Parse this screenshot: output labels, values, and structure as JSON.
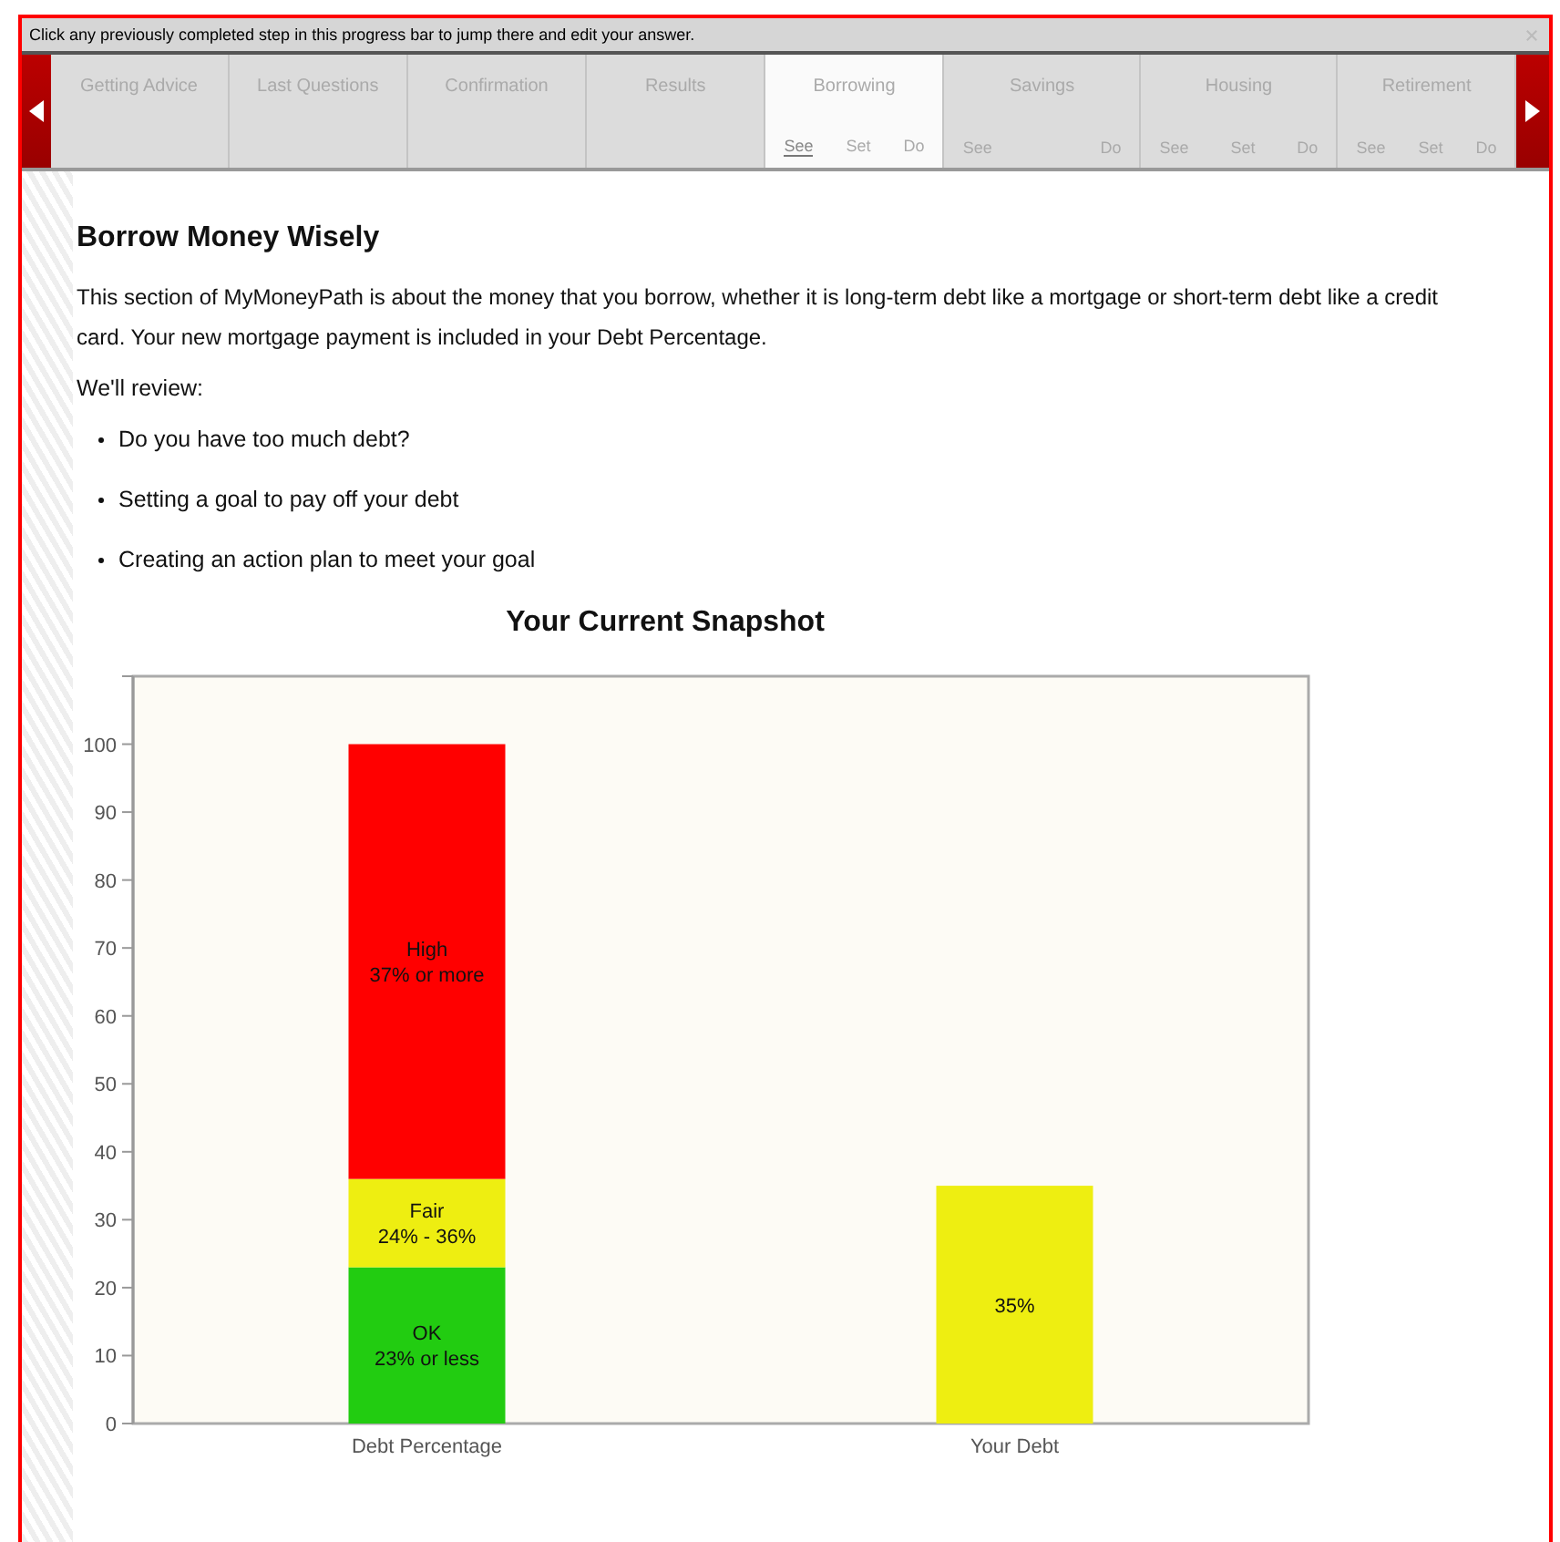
{
  "info_bar": {
    "text": "Click any previously completed step in this progress bar to jump there and edit your answer."
  },
  "tabs": [
    {
      "label": "Getting Advice",
      "selected": false
    },
    {
      "label": "Last Questions",
      "selected": false
    },
    {
      "label": "Confirmation",
      "selected": false
    },
    {
      "label": "Results",
      "selected": false
    },
    {
      "label": "Borrowing",
      "selected": true,
      "steps": [
        {
          "label": "See",
          "selected": true
        },
        {
          "label": "Set",
          "selected": false
        },
        {
          "label": "Do",
          "selected": false
        }
      ]
    },
    {
      "label": "Savings",
      "selected": false,
      "steps": [
        {
          "label": "See",
          "selected": false
        },
        {
          "label": "Do",
          "selected": false
        }
      ]
    },
    {
      "label": "Housing",
      "selected": false,
      "steps": [
        {
          "label": "See",
          "selected": false
        },
        {
          "label": "Set",
          "selected": false
        },
        {
          "label": "Do",
          "selected": false
        }
      ]
    },
    {
      "label": "Retirement",
      "selected": false,
      "steps": [
        {
          "label": "See",
          "selected": false
        },
        {
          "label": "Set",
          "selected": false
        },
        {
          "label": "Do",
          "selected": false
        }
      ]
    }
  ],
  "content": {
    "heading": "Borrow Money Wisely",
    "intro": "This section of MyMoneyPath is about the money that you borrow, whether it is long-term debt like a mortgage or short-term debt like a credit card. Your new mortgage payment is included in your Debt Percentage.",
    "review_label": "We'll review:",
    "bullets": [
      "Do you have too much debt?",
      "Setting a goal to pay off your debt",
      "Creating an action plan to meet your goal"
    ]
  },
  "snapshot": {
    "chart_data": {
      "type": "bar",
      "title": "Your Current Snapshot",
      "categories": [
        "Debt Percentage",
        "Your Debt"
      ],
      "stacked": true,
      "ylim": [
        0,
        110
      ],
      "yticks": [
        0,
        10,
        20,
        30,
        40,
        50,
        60,
        70,
        80,
        90,
        100
      ],
      "series": [
        {
          "color": "#22cc11",
          "values": [
            23,
            null
          ]
        },
        {
          "color": "#eeee11",
          "values": [
            13,
            35
          ],
          "value_labels": [
            null,
            "35%"
          ]
        },
        {
          "color": "#ff0000",
          "values": [
            64,
            null
          ]
        }
      ],
      "annotations": [
        {
          "x": "Debt Percentage",
          "y": 23,
          "text": "OK\n23% or less"
        },
        {
          "x": "Debt Percentage",
          "y": 36,
          "text": "Fair\n24% - 36%"
        },
        "High\n37% or more"
      ]
    }
  }
}
